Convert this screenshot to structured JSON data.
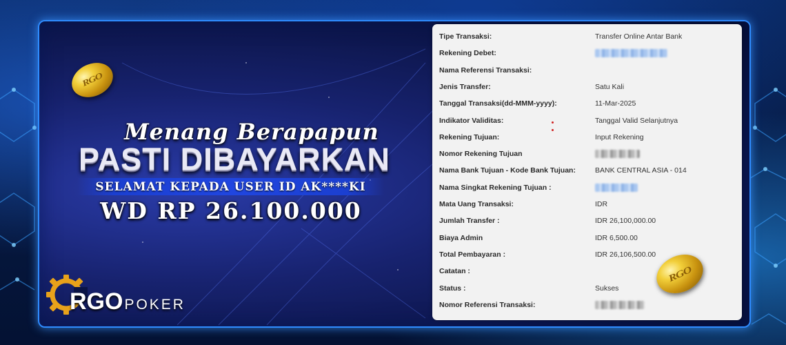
{
  "banner": {
    "headline_script": "Menang Berapapun",
    "headline_main": "PASTI DIBAYARKAN",
    "congrats": "SELAMAT KEPADA USER ID AK****KI",
    "withdrawal": "WD RP 26.100.000",
    "coin_text": "RGO"
  },
  "logo": {
    "name": "RGO",
    "sub": "POKER",
    "icon": "gear-chip-icon"
  },
  "receipt": {
    "rows": [
      {
        "label": "Tipe Transaksi:",
        "value": "Transfer Online Antar Bank"
      },
      {
        "label": "Rekening Debet:",
        "value": "",
        "redacted": "blue"
      },
      {
        "label": "Nama Referensi Transaksi:",
        "value": ""
      },
      {
        "label": "Jenis Transfer:",
        "value": "Satu Kali"
      },
      {
        "label": "Tanggal Transaksi(dd-MMM-yyyy):",
        "value": "11-Mar-2025"
      },
      {
        "label": "Indikator Validitas:",
        "value": "Tanggal Valid Selanjutnya"
      },
      {
        "label": "Rekening Tujuan:",
        "value": "Input Rekening"
      },
      {
        "label": "Nomor Rekening Tujuan",
        "value": "",
        "redacted": "gray"
      },
      {
        "label": "Nama Bank Tujuan - Kode Bank Tujuan:",
        "value": "BANK CENTRAL ASIA - 014"
      },
      {
        "label": "Nama Singkat Rekening Tujuan :",
        "value": "",
        "redacted": "blue"
      },
      {
        "label": "Mata Uang Transaksi:",
        "value": "IDR"
      },
      {
        "label": "Jumlah Transfer :",
        "value": "IDR 26,100,000.00"
      },
      {
        "label": "Biaya Admin",
        "value": "IDR 6,500.00"
      },
      {
        "label": "Total Pembayaran :",
        "value": "IDR 26,106,500.00"
      },
      {
        "label": "Catatan :",
        "value": ""
      },
      {
        "label": "Status :",
        "value": "Sukses"
      },
      {
        "label": "Nomor Referensi Transaksi:",
        "value": "",
        "redacted": "gray"
      }
    ]
  },
  "colors": {
    "panel_border": "#2f8cff",
    "congrats_bar": "#2046e0",
    "receipt_bg": "#f2f2f2",
    "coin_gold": "#f2cf3a"
  }
}
